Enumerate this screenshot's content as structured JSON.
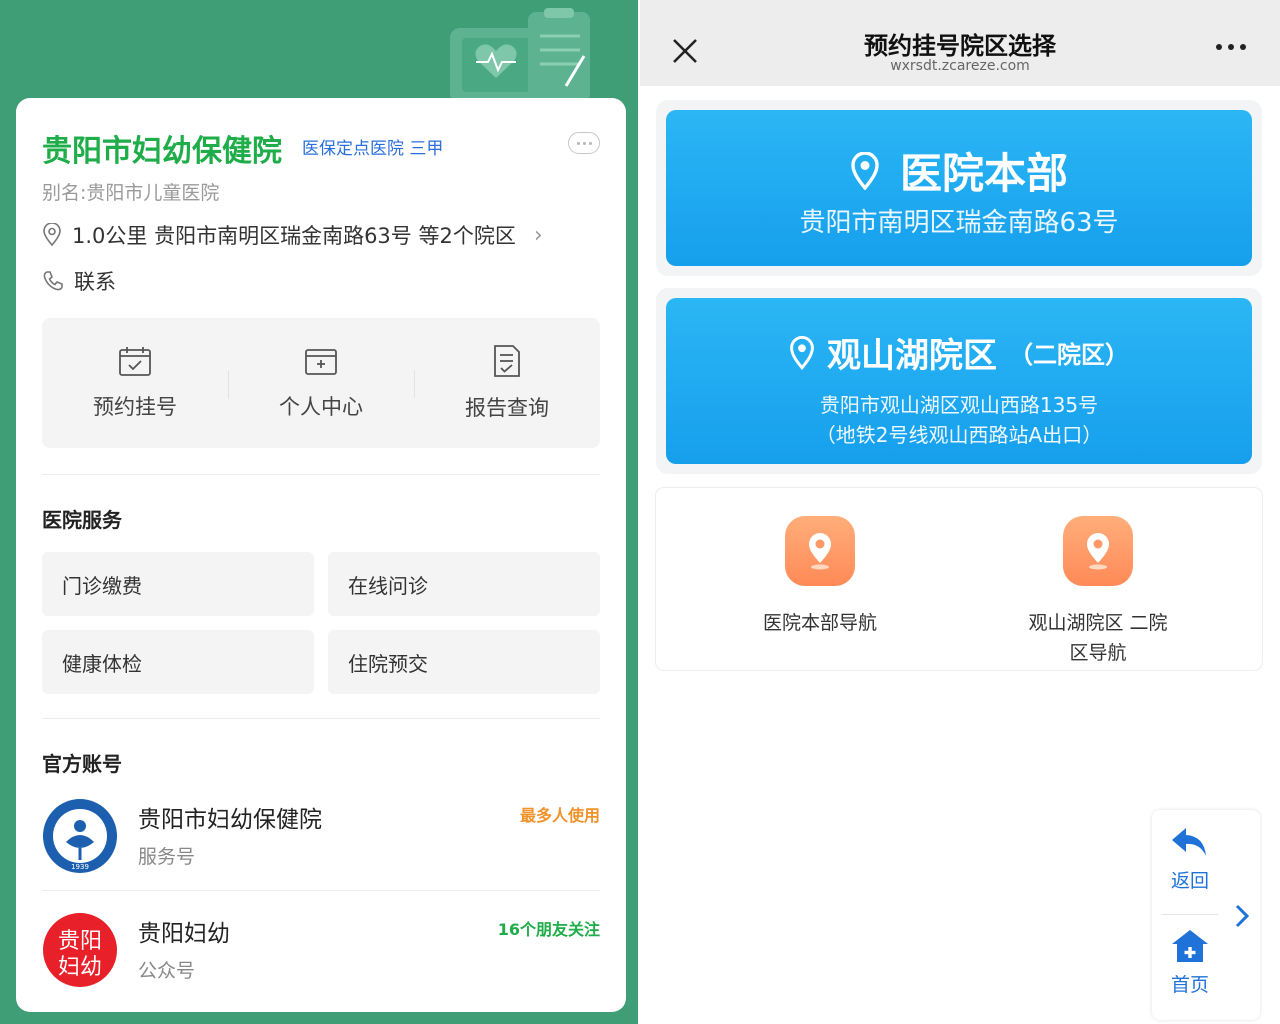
{
  "left": {
    "hospital_name": "贵阳市妇幼保健院",
    "tags": "医保定点医院 三甲",
    "alias": "别名:贵阳市儿童医院",
    "address": "1.0公里 贵阳市南明区瑞金南路63号 等2个院区",
    "contact": "联系",
    "quick_actions": [
      {
        "label": "预约挂号",
        "icon": "calendar-check-icon"
      },
      {
        "label": "个人中心",
        "icon": "wallet-card-icon"
      },
      {
        "label": "报告查询",
        "icon": "document-report-icon"
      }
    ],
    "services_title": "医院服务",
    "services": [
      "门诊缴费",
      "在线问诊",
      "健康体检",
      "住院预交"
    ],
    "accounts_title": "官方账号",
    "accounts": [
      {
        "name": "贵阳市妇幼保健院",
        "type": "服务号",
        "tag": "最多人使用",
        "tag_color": "#f0932b",
        "logo_year": "1939"
      },
      {
        "name": "贵阳妇幼",
        "type": "公众号",
        "tag": "16个朋友关注",
        "tag_color": "#1fad4a",
        "logo_text": "贵阳妇幼"
      }
    ],
    "colors": {
      "background": "#3f9e76",
      "name_green": "#1fad4a",
      "tag_blue": "#2a6fdb"
    }
  },
  "right": {
    "title": "预约挂号院区选择",
    "url": "wxrsdt.zcareze.com",
    "campus_main": {
      "name": "医院本部",
      "address": "贵阳市南明区瑞金南路63号"
    },
    "campus_second": {
      "name": "观山湖院区",
      "sub": "（二院区）",
      "address_line1": "贵阳市观山湖区观山西路135号",
      "address_line2": "（地铁2号线观山西路站A出口）"
    },
    "nav": [
      {
        "label": "医院本部导航",
        "icon": "location-pin-icon"
      },
      {
        "label": "观山湖院区 二院区导航",
        "icon": "location-pin-icon"
      }
    ],
    "float_buttons": {
      "back": "返回",
      "home": "首页"
    },
    "colors": {
      "campus_blue": "#169fec",
      "nav_orange": "#ff8a58",
      "float_blue": "#1f73d8"
    }
  }
}
